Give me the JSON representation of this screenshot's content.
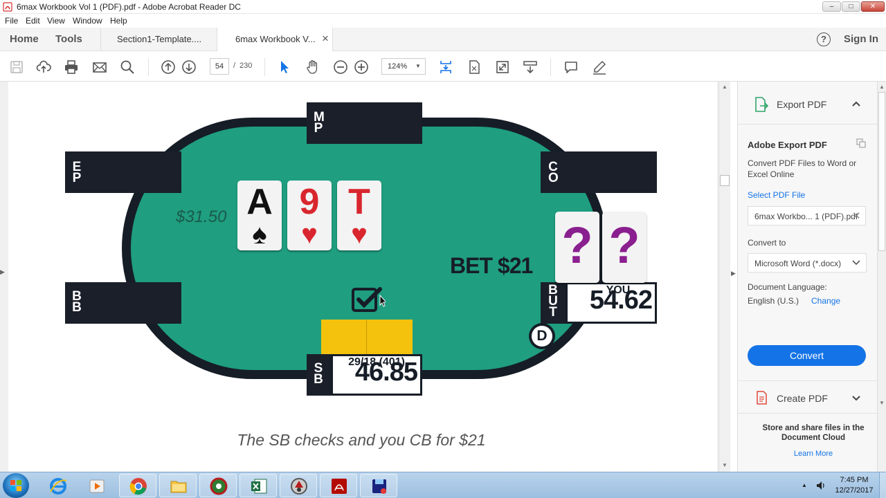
{
  "window": {
    "title": "6max Workbook Vol 1 (PDF).pdf - Adobe Acrobat Reader DC",
    "min": "–",
    "max": "□",
    "close": "✕"
  },
  "menu": [
    "File",
    "Edit",
    "View",
    "Window",
    "Help"
  ],
  "tabs": {
    "home": "Home",
    "tools": "Tools",
    "doc1": "Section1-Template....",
    "doc2": "6max Workbook V...",
    "doc2_close": "×",
    "help": "?",
    "signin": "Sign In"
  },
  "toolbar": {
    "page_current": "54",
    "page_sep": "/",
    "page_total": "230",
    "zoom": "124%",
    "icons": [
      "save-icon",
      "upload-icon",
      "print-icon",
      "mail-icon",
      "search-icon",
      "page-up-icon",
      "page-down-icon",
      "select-icon",
      "hand-icon",
      "zoom-out-icon",
      "zoom-in-icon",
      "scroll-mode-icon",
      "fit-page-icon",
      "full-screen-icon",
      "read-mode-icon",
      "comment-icon",
      "highlight-icon"
    ]
  },
  "poker": {
    "seats": {
      "mp": [
        "M",
        "P"
      ],
      "ep": [
        "E",
        "P"
      ],
      "co": [
        "C",
        "O"
      ],
      "bb": [
        "B",
        "B"
      ],
      "but": [
        "B",
        "U",
        "T"
      ],
      "sb": [
        "S",
        "B"
      ]
    },
    "pot": "$31.50",
    "board": [
      {
        "rank": "A",
        "suit": "♠",
        "color": "#111111"
      },
      {
        "rank": "9",
        "suit": "♥",
        "color": "#d9262e"
      },
      {
        "rank": "T",
        "suit": "♥",
        "color": "#d9262e"
      }
    ],
    "hero_cards": [
      "?",
      "?"
    ],
    "hero_card_color": "#8a1f8f",
    "bet": "BET $21",
    "hero_label": "YOU",
    "hero_stack": "54.62",
    "dealer": "D",
    "sb_stats": "29/18 (401)",
    "sb_stack": "46.85",
    "felt_color": "#1f9e80",
    "rail_color": "#161d26",
    "chip_color": "#f4c20d",
    "caption": "The SB checks and you CB for $21"
  },
  "panel": {
    "export_title": "Export PDF",
    "adobe_export": "Adobe Export PDF",
    "convert_desc": "Convert PDF Files to Word or Excel Online",
    "select_file": "Select PDF File",
    "file_value": "6max Workbo... 1 (PDF).pdf",
    "convert_to": "Convert to",
    "format": "Microsoft Word (*.docx)",
    "doc_lang": "Document Language:",
    "lang": "English (U.S.)",
    "change": "Change",
    "convert_btn": "Convert",
    "create_pdf": "Create PDF",
    "store_share": "Store and share files in the Document Cloud",
    "learn_more": "Learn More",
    "accent": "#1473e6"
  },
  "taskbar": {
    "time": "7:45 PM",
    "date": "12/27/2017",
    "apps": [
      "internet-explorer-icon",
      "media-player-icon",
      "chrome-icon",
      "file-explorer-icon",
      "poker-tracker-icon",
      "excel-icon",
      "poker-client-icon",
      "acrobat-icon",
      "save-app-icon"
    ]
  }
}
